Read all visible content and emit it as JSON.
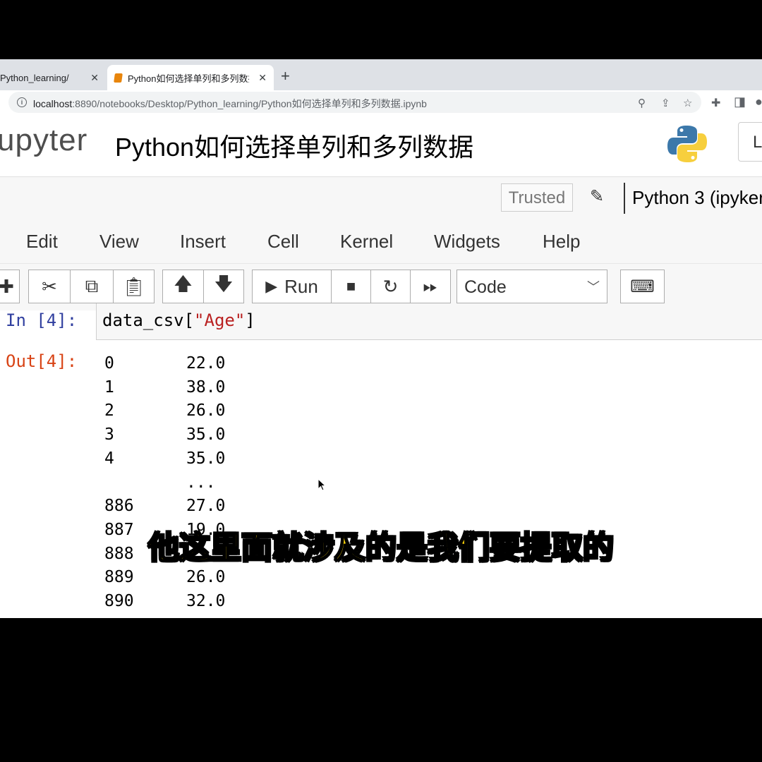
{
  "browser": {
    "tabs": [
      {
        "label": "Python_learning/"
      },
      {
        "label": "Python如何选择单列和多列数据"
      }
    ],
    "url_host": "localhost",
    "url_rest": ":8890/notebooks/Desktop/Python_learning/Python如何选择单列和多列数据.ipynb"
  },
  "jupyter": {
    "logo_text": "upyter",
    "notebook_title": "Python如何选择单列和多列数据",
    "logout_label": "L",
    "trusted_label": "Trusted",
    "kernel_name": "Python 3 (ipyker"
  },
  "menu": [
    "Edit",
    "View",
    "Insert",
    "Cell",
    "Kernel",
    "Widgets",
    "Help"
  ],
  "toolbar": {
    "run_label": "Run",
    "cell_type": "Code"
  },
  "cell": {
    "in_prompt": "In [4]:",
    "code_prefix": "data_csv[",
    "code_string": "\"Age\"",
    "code_suffix": "]",
    "out_prompt": "Out[4]:",
    "output_rows": [
      {
        "index": "0",
        "value": "22.0"
      },
      {
        "index": "1",
        "value": "38.0"
      },
      {
        "index": "2",
        "value": "26.0"
      },
      {
        "index": "3",
        "value": "35.0"
      },
      {
        "index": "4",
        "value": "35.0"
      },
      {
        "index": "",
        "value": "..."
      },
      {
        "index": "886",
        "value": "27.0"
      },
      {
        "index": "887",
        "value": "19.0"
      },
      {
        "index": "888",
        "value": ""
      },
      {
        "index": "889",
        "value": "26.0"
      },
      {
        "index": "890",
        "value": "32.0"
      }
    ]
  },
  "subtitle": "他这里面就涉及的是我们要提取的"
}
